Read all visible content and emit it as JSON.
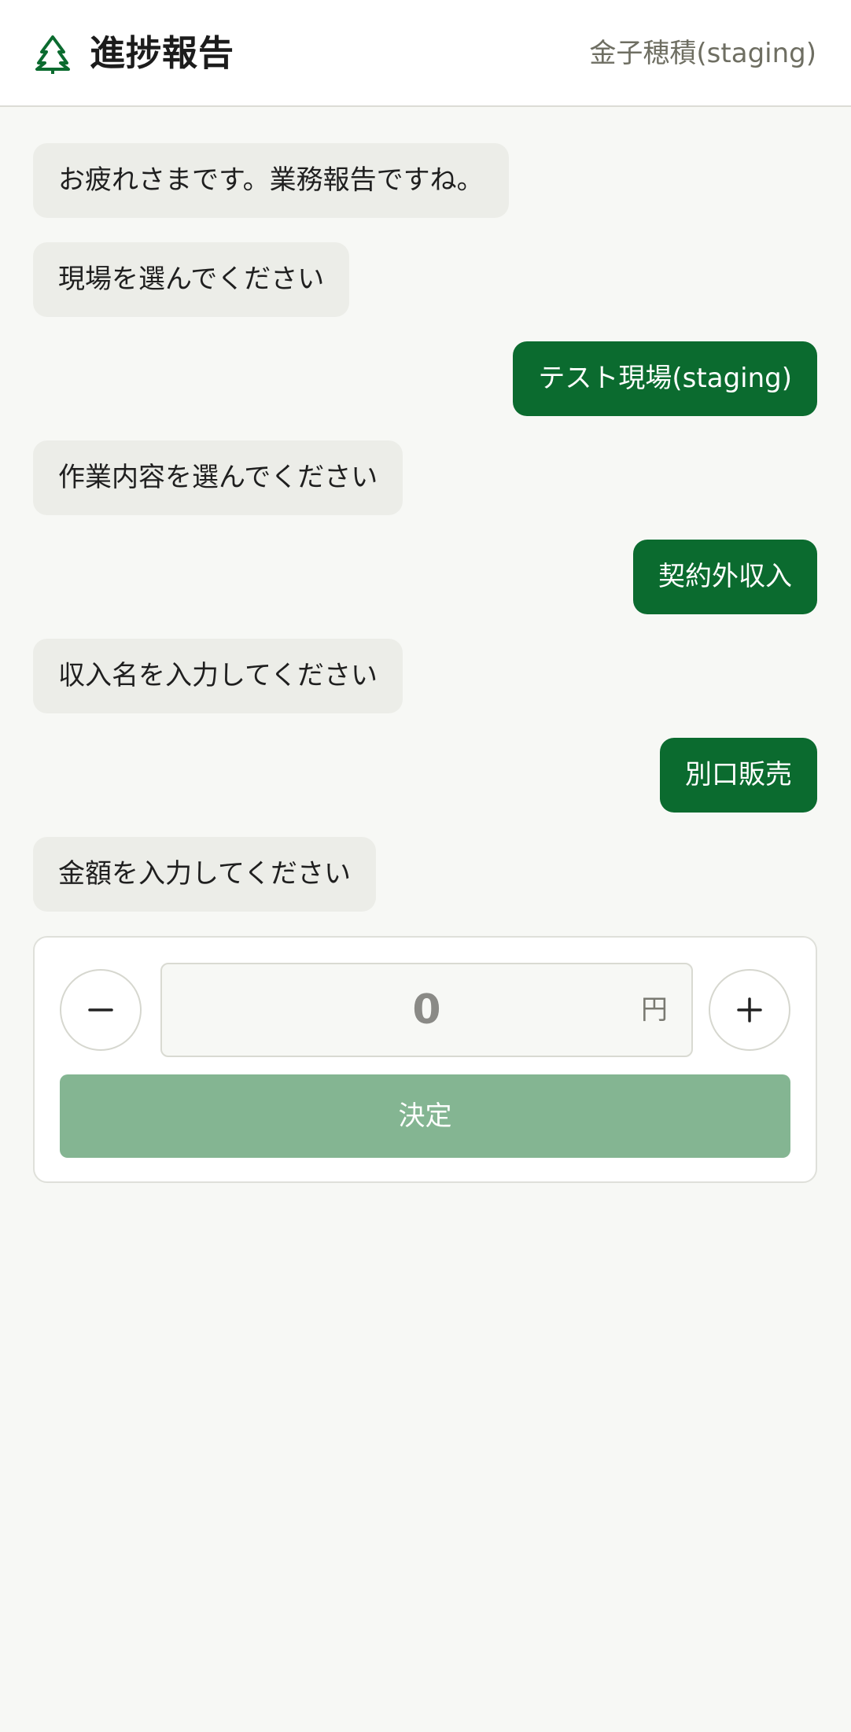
{
  "header": {
    "title": "進捗報告",
    "user_name": "金子穂積(staging)",
    "logo_icon": "tree-icon"
  },
  "chat": {
    "messages": [
      {
        "from": "bot",
        "text": "お疲れさまです。業務報告ですね。"
      },
      {
        "from": "bot",
        "text": "現場を選んでください"
      },
      {
        "from": "user",
        "text": "テスト現場(staging)"
      },
      {
        "from": "bot",
        "text": "作業内容を選んでください"
      },
      {
        "from": "user",
        "text": "契約外収入"
      },
      {
        "from": "bot",
        "text": "収入名を入力してください"
      },
      {
        "from": "user",
        "text": "別口販売"
      },
      {
        "from": "bot",
        "text": "金額を入力してください"
      }
    ]
  },
  "amount_input": {
    "value": "0",
    "unit": "円",
    "decrement_icon": "minus-icon",
    "increment_icon": "plus-icon",
    "submit_label": "決定"
  },
  "colors": {
    "brand_green": "#0b6b2f",
    "bot_bubble": "#ecede8",
    "submit_disabled": "#84b592",
    "background": "#f7f8f5"
  }
}
